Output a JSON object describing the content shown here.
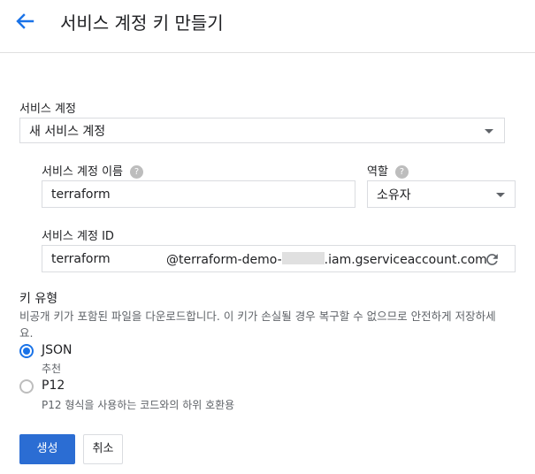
{
  "header": {
    "title": "서비스 계정 키 만들기"
  },
  "service_account": {
    "label": "서비스 계정",
    "selected": "새 서비스 계정",
    "name_label": "서비스 계정 이름",
    "name_value": "terraform",
    "role_label": "역할",
    "role_value": "소유자",
    "id_label": "서비스 계정 ID",
    "id_value": "terraform",
    "id_domain_prefix": "@terraform-demo-",
    "id_domain_suffix": ".iam.gserviceaccount.com"
  },
  "key_type": {
    "label": "키 유형",
    "description": "비공개 키가 포함된 파일을 다운로드합니다. 이 키가 손실될 경우 복구할 수 없으므로 안전하게 저장하세",
    "description_cont": "요.",
    "options": [
      {
        "label": "JSON",
        "sub": "추천",
        "selected": true
      },
      {
        "label": "P12",
        "sub": "P12 형식을 사용하는 코드와의 하위 호환용",
        "selected": false
      }
    ]
  },
  "actions": {
    "create": "생성",
    "cancel": "취소"
  },
  "colors": {
    "accent": "#1a73e8",
    "primary_button": "#2b6dd3"
  },
  "icons": {
    "back": "arrow-left-icon",
    "help": "help-circle-icon",
    "refresh": "refresh-icon",
    "dropdown": "chevron-down-icon"
  }
}
